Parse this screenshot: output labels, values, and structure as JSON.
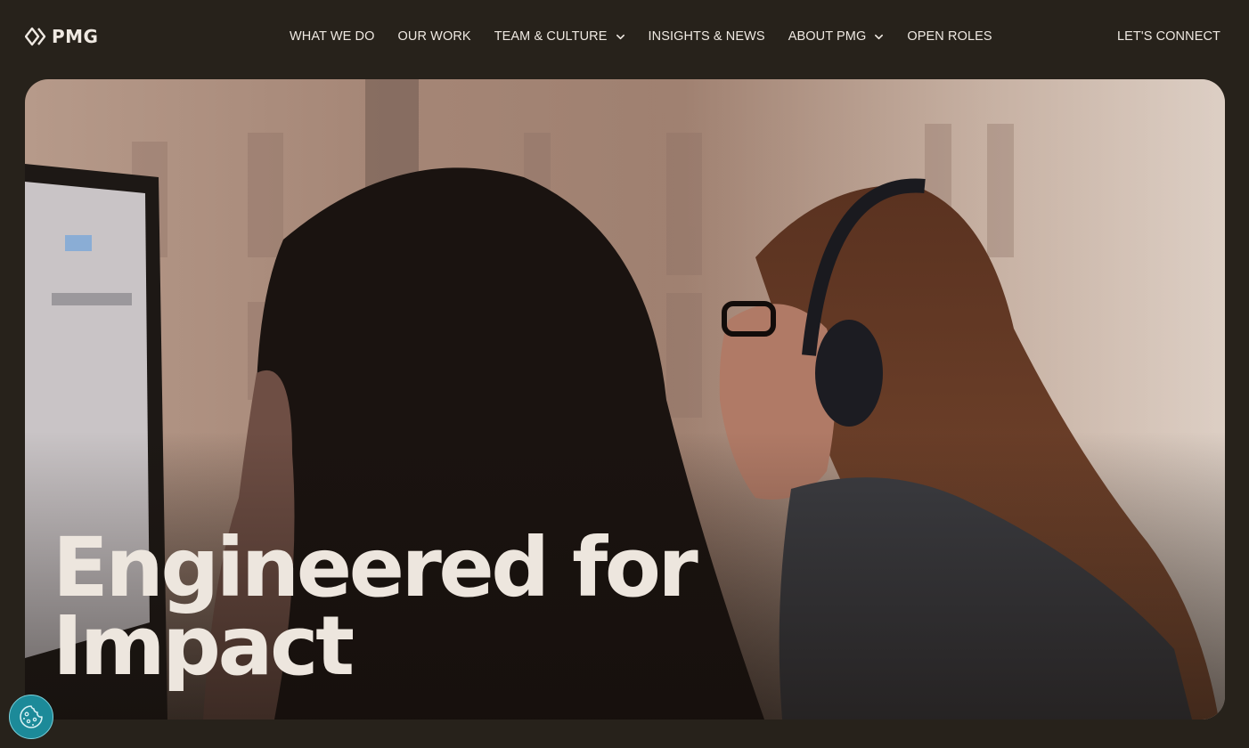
{
  "brand": {
    "name": "PMG",
    "icon": "pmg-diamond-logo-icon"
  },
  "nav": {
    "items": [
      {
        "label": "WHAT WE DO",
        "has_dropdown": false
      },
      {
        "label": "OUR WORK",
        "has_dropdown": false
      },
      {
        "label": "TEAM & CULTURE",
        "has_dropdown": true
      },
      {
        "label": "INSIGHTS & NEWS",
        "has_dropdown": false
      },
      {
        "label": "ABOUT PMG",
        "has_dropdown": true
      },
      {
        "label": "OPEN ROLES",
        "has_dropdown": false
      }
    ],
    "cta": "LET'S CONNECT"
  },
  "hero": {
    "title_line1": "Engineered for",
    "title_line2": "Impact",
    "background": "office-photo-two-women-at-computer"
  },
  "cookie_button": {
    "icon": "cookie-icon",
    "color": "#1c8a99"
  },
  "colors": {
    "page_bg": "#27221b",
    "text": "#efe9e2",
    "hero_title": "#ede6de"
  }
}
